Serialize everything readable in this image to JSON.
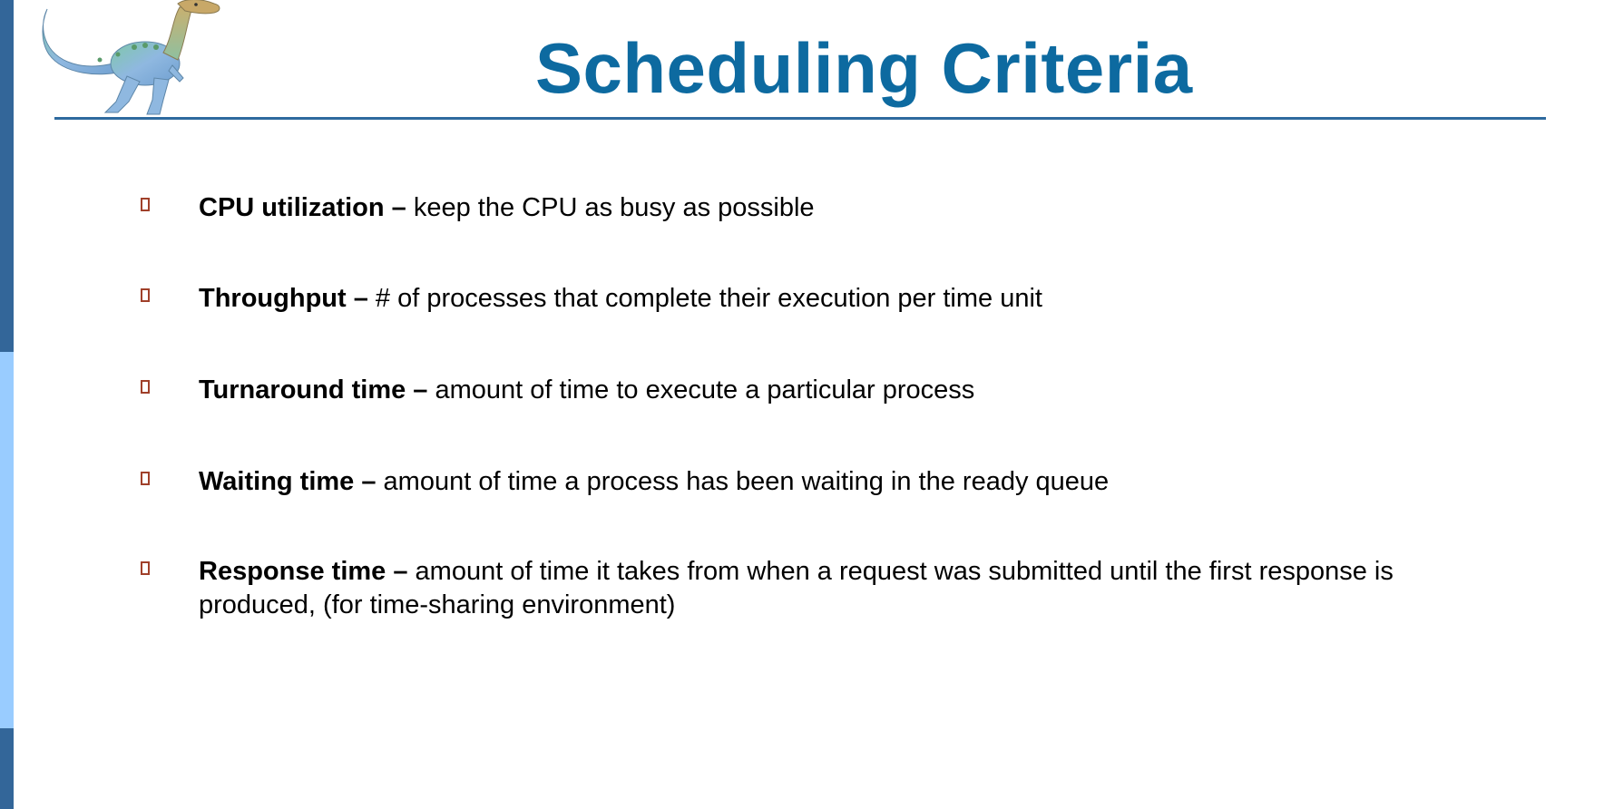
{
  "slide": {
    "title": "Scheduling Criteria",
    "logo_icon": "dinosaur-icon",
    "bullet_icon": "square-bullet-icon",
    "colors": {
      "title": "#0d6aa0",
      "rule": "#2e6a9e",
      "side_bar_dark": "#336699",
      "side_bar_light": "#99ccff",
      "bullet_marker": "#a0402a"
    },
    "bullets": [
      {
        "term": "CPU utilization –",
        "text": " keep the CPU as busy as possible"
      },
      {
        "term": "Throughput –",
        "text": " # of processes that complete their execution per time unit"
      },
      {
        "term": "Turnaround time –",
        "text": " amount of time to execute a particular process"
      },
      {
        "term": "Waiting time –",
        "text": " amount of time a process has been waiting in the ready queue"
      },
      {
        "term": "Response time –",
        "text": " amount of time it takes from when a request was submitted until the first response is produced, (for time-sharing environment)"
      }
    ]
  }
}
